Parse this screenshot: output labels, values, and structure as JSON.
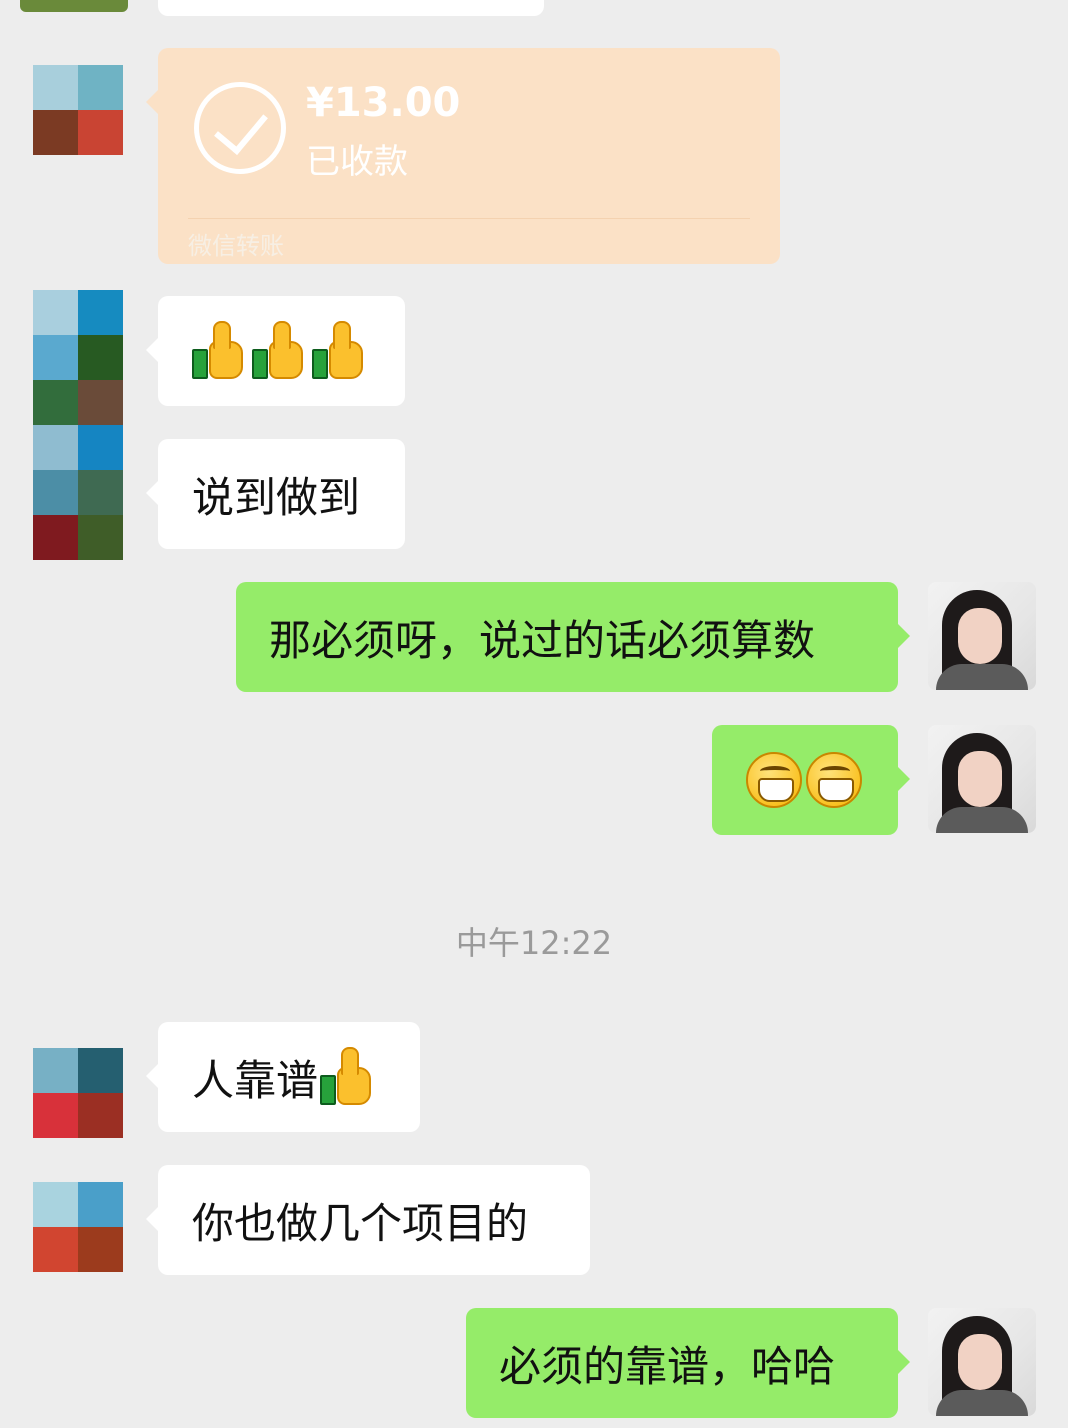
{
  "transfer": {
    "amount": "¥13.00",
    "status": "已收款",
    "footer": "微信转账"
  },
  "messages": {
    "m1_icons": [
      "thumbs-up",
      "thumbs-up",
      "thumbs-up"
    ],
    "m2": "说到做到",
    "m3": "那必须呀，说过的话必须算数",
    "m4_icons": [
      "grinning-face",
      "grinning-face"
    ],
    "m5": "人靠谱",
    "m6": "你也做几个项目的",
    "m7": "必须的靠谱，哈哈"
  },
  "timestamp": "中午12:22",
  "colors": {
    "background": "#ededed",
    "incoming_bubble": "#ffffff",
    "outgoing_bubble": "#95ec69",
    "transfer_card": "#fbe1c6"
  }
}
